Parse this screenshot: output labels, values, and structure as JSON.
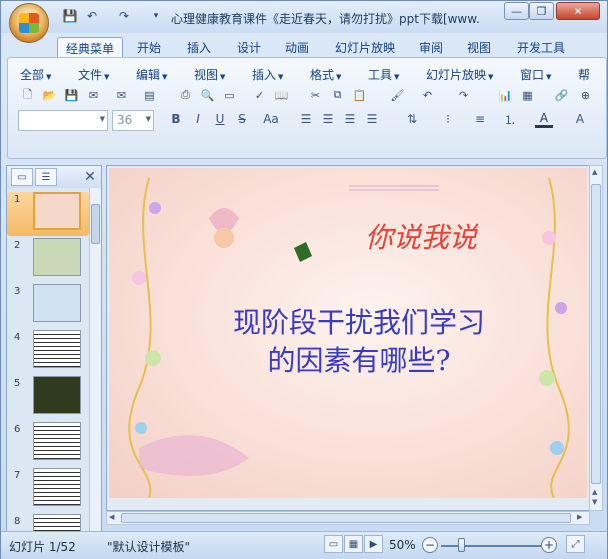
{
  "window": {
    "title": "心理健康教育课件《走近春天，请勿打扰》ppt下载[www.",
    "controls": {
      "minimize": "—",
      "restore": "❐",
      "close": "✕"
    }
  },
  "quick_access": {
    "save_icon": "save-icon",
    "undo_icon": "undo-icon",
    "redo_icon": "redo-icon",
    "customize": "▾"
  },
  "ribbon_tabs": [
    "经典菜单",
    "开始",
    "插入",
    "设计",
    "动画",
    "幻灯片放映",
    "审阅",
    "视图",
    "开发工具"
  ],
  "active_tab": "经典菜单",
  "classic_menus": [
    "全部",
    "文件",
    "编辑",
    "视图",
    "插入",
    "格式",
    "工具",
    "幻灯片放映",
    "窗口",
    "帮"
  ],
  "font": {
    "name": "",
    "size": "36"
  },
  "format_buttons": {
    "bold": "B",
    "italic": "I",
    "underline": "U",
    "strike": "S",
    "case": "Aa"
  },
  "slide": {
    "heading": "你说我说",
    "question_line1": "现阶段干扰我们学习",
    "question_line2": "的因素有哪些?"
  },
  "thumbnails": [
    {
      "num": "1",
      "color": "#f6d8c8"
    },
    {
      "num": "2",
      "color": "#c9d9b8"
    },
    {
      "num": "3",
      "color": "#cfe1f2"
    },
    {
      "num": "4",
      "color": "#ffffff"
    },
    {
      "num": "5",
      "color": "#2f3a1f"
    },
    {
      "num": "6",
      "color": "#ffffff"
    },
    {
      "num": "7",
      "color": "#ffffff"
    },
    {
      "num": "8",
      "color": "#ffffff"
    }
  ],
  "statusbar": {
    "slide_info": "幻灯片 1/52",
    "theme": "\"默认设计模板\"",
    "zoom": "50%"
  },
  "colors": {
    "heading": "#e8423a",
    "question": "#3a3bc4",
    "selected_thumb": "#f5b965"
  }
}
